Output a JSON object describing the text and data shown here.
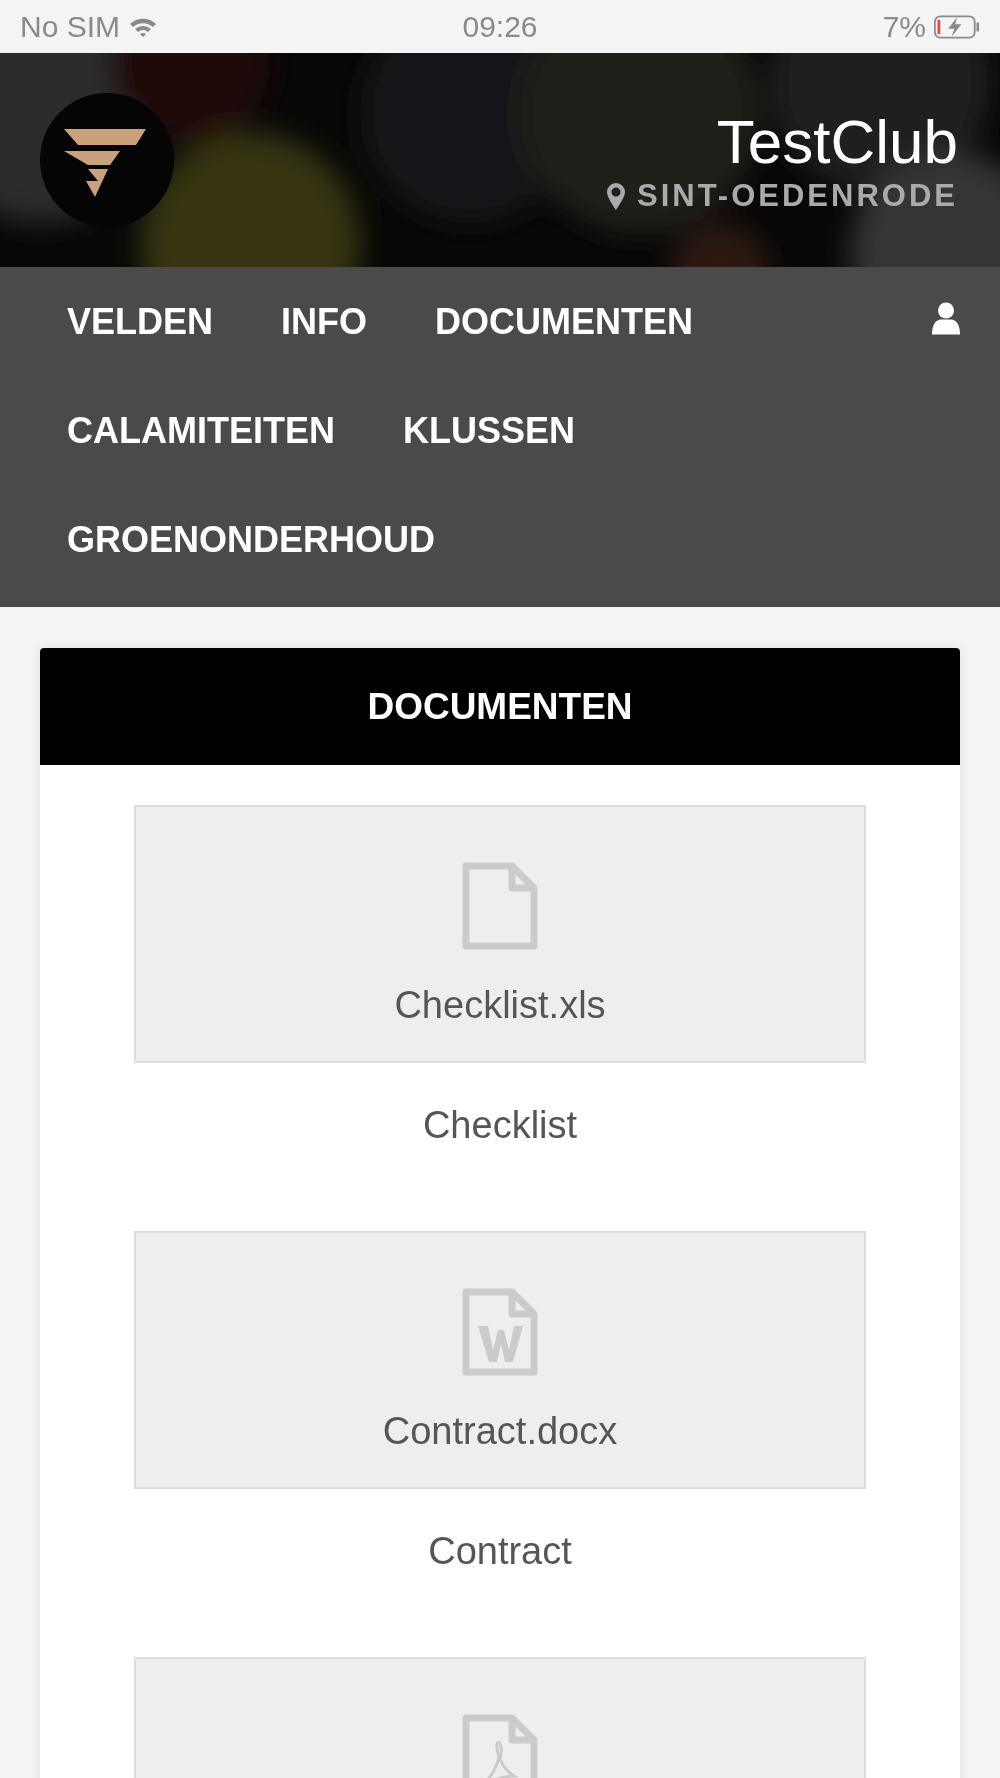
{
  "status_bar": {
    "carrier": "No SIM",
    "time": "09:26",
    "battery": "7%"
  },
  "header": {
    "club_name": "TestClub",
    "location": "SINT-OEDENRODE"
  },
  "nav": {
    "items": [
      {
        "label": "VELDEN"
      },
      {
        "label": "INFO"
      },
      {
        "label": "DOCUMENTEN"
      },
      {
        "label": "CALAMITEITEN"
      },
      {
        "label": "KLUSSEN"
      },
      {
        "label": "GROENONDERHOUD"
      }
    ]
  },
  "documents_panel": {
    "title": "DOCUMENTEN",
    "documents": [
      {
        "kind": "file",
        "filename": "Checklist.xls",
        "title": "Checklist"
      },
      {
        "kind": "word",
        "filename": "Contract.docx",
        "title": "Contract"
      },
      {
        "kind": "pdf"
      }
    ]
  }
}
